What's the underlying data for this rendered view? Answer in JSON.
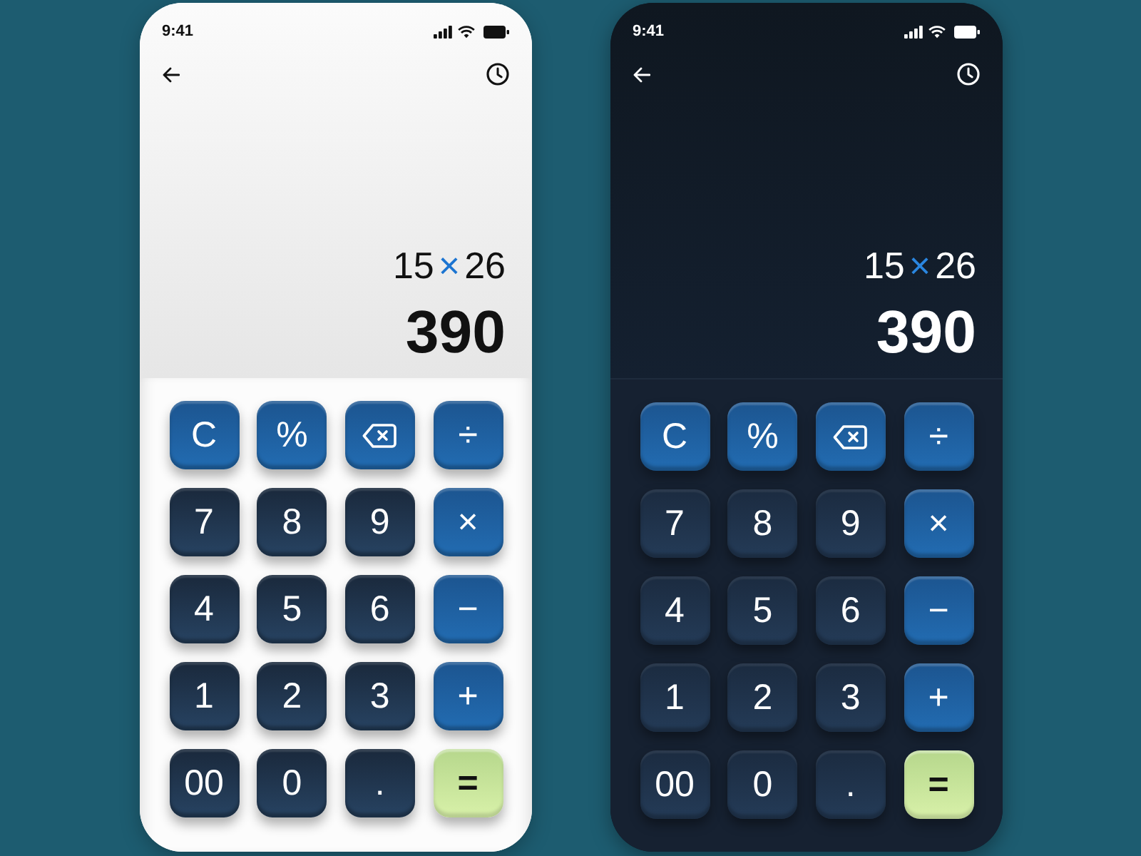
{
  "phones": [
    {
      "kind": "light",
      "status_bar": {
        "time": "9:41"
      },
      "display": {
        "operand_1": "15",
        "operator": "×",
        "operand_2": "26",
        "result": "390"
      },
      "keys": [
        {
          "kind": "action",
          "label": "C"
        },
        {
          "kind": "action",
          "label": "%"
        },
        {
          "kind": "backspace"
        },
        {
          "kind": "action",
          "label": "÷"
        },
        {
          "kind": "digit",
          "label": "7"
        },
        {
          "kind": "digit",
          "label": "8"
        },
        {
          "kind": "digit",
          "label": "9"
        },
        {
          "kind": "action",
          "label": "×"
        },
        {
          "kind": "digit",
          "label": "4"
        },
        {
          "kind": "digit",
          "label": "5"
        },
        {
          "kind": "digit",
          "label": "6"
        },
        {
          "kind": "action",
          "label": "−"
        },
        {
          "kind": "digit",
          "label": "1"
        },
        {
          "kind": "digit",
          "label": "2"
        },
        {
          "kind": "digit",
          "label": "3"
        },
        {
          "kind": "action",
          "label": "+"
        },
        {
          "kind": "digit",
          "label": "00"
        },
        {
          "kind": "digit",
          "label": "0"
        },
        {
          "kind": "digit",
          "label": "."
        },
        {
          "kind": "equals",
          "label": "="
        }
      ]
    },
    {
      "kind": "dark",
      "status_bar": {
        "time": "9:41"
      },
      "display": {
        "operand_1": "15",
        "operator": "×",
        "operand_2": "26",
        "result": "390"
      },
      "keys": [
        {
          "kind": "action",
          "label": "C"
        },
        {
          "kind": "action",
          "label": "%"
        },
        {
          "kind": "backspace"
        },
        {
          "kind": "action",
          "label": "÷"
        },
        {
          "kind": "digit",
          "label": "7"
        },
        {
          "kind": "digit",
          "label": "8"
        },
        {
          "kind": "digit",
          "label": "9"
        },
        {
          "kind": "action",
          "label": "×"
        },
        {
          "kind": "digit",
          "label": "4"
        },
        {
          "kind": "digit",
          "label": "5"
        },
        {
          "kind": "digit",
          "label": "6"
        },
        {
          "kind": "action",
          "label": "−"
        },
        {
          "kind": "digit",
          "label": "1"
        },
        {
          "kind": "digit",
          "label": "2"
        },
        {
          "kind": "digit",
          "label": "3"
        },
        {
          "kind": "action",
          "label": "+"
        },
        {
          "kind": "digit",
          "label": "00"
        },
        {
          "kind": "digit",
          "label": "0"
        },
        {
          "kind": "digit",
          "label": "."
        },
        {
          "kind": "equals",
          "label": "="
        }
      ]
    }
  ]
}
